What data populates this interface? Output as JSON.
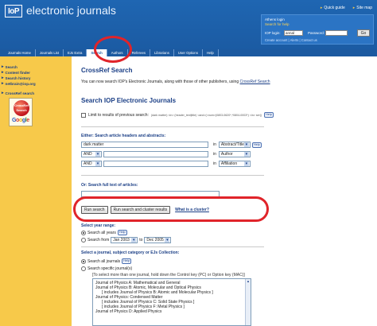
{
  "header": {
    "logo": "IoP",
    "brand": "electronic journals",
    "top_links": [
      "Quick guide",
      "Site map"
    ],
    "login": {
      "athens_login": "Athens login",
      "search_for_help": "Search for help",
      "iop_login_label": "IOP login:",
      "username_value": "annal",
      "password_label": "Password:",
      "go_label": "Go",
      "footer_links": "Create account | Alerts | Contact us"
    }
  },
  "nav": {
    "items": [
      "Journals Home",
      "Journals List",
      "EJs Extra",
      "Search",
      "Authors",
      "Referees",
      "Librarians",
      "User Options",
      "Help"
    ],
    "active_index": 3
  },
  "sidebar": {
    "links": [
      "Search",
      "Content finder",
      "Search history",
      "netbrain@iop.org"
    ],
    "crossref_link": "CrossRef search",
    "badge_text": "CrossRef Search",
    "google": [
      "G",
      "o",
      "o",
      "g",
      "l",
      "e"
    ]
  },
  "main": {
    "crossref_heading": "CrossRef Search",
    "intro_text": "You can now search IOP's Electronic Journals, along with those of other publishers, using ",
    "intro_link": "CrossRef Search",
    "search_heading": "Search IOP Electronic Journals",
    "limit_label": "Limit to results of previous search:",
    "limit_detail": "(dark matter) <in> (header_text|title) <and>(<num>(0803-0620*,*0804-0003*) <in> ser|) ",
    "help": "Help",
    "either_label": "Either: Search article headers and abstracts:",
    "rows": [
      {
        "op": "",
        "term": "dark matter",
        "in": "in",
        "field": "Abstract/Title"
      },
      {
        "op": "AND",
        "term": "",
        "in": "in",
        "field": "Author"
      },
      {
        "op": "AND",
        "term": "",
        "in": "in",
        "field": "Affiliation"
      }
    ],
    "fulltext_label": "Or: Search full text of articles:",
    "run_search": "Run search",
    "run_cluster": "Run search and cluster results",
    "what_cluster": "What is a cluster?",
    "year_label": "Select year range:",
    "search_all_years": "Search all years",
    "search_from": "Search from",
    "from_value": "Jan 2003",
    "to_label": "to",
    "to_value": "Dec 2005",
    "journal_label": "Select a journal, subject category or EJs Collection:",
    "search_all_journals": "Search all journals",
    "search_specific": "Search specific journal(s)",
    "specific_note": "[To select more than one journal, hold down the Control key (PC) or Option key (MAC)]",
    "journals": [
      {
        "text": "Journal of Physics A: Mathematical and General",
        "sub": false
      },
      {
        "text": "Journal of Physics B: Atomic, Molecular and Optical Physics",
        "sub": false
      },
      {
        "text": "[ includes Journal of Physics B: Atomic and Molecular Physics ]",
        "sub": true
      },
      {
        "text": "Journal of Physics: Condensed Matter",
        "sub": false
      },
      {
        "text": "[ includes Journal of Physics C: Solid State Physics ]",
        "sub": true
      },
      {
        "text": "[ includes Journal of Physics F: Metal Physics ]",
        "sub": true
      },
      {
        "text": "Journal of Physics D: Applied Physics",
        "sub": false
      }
    ]
  }
}
